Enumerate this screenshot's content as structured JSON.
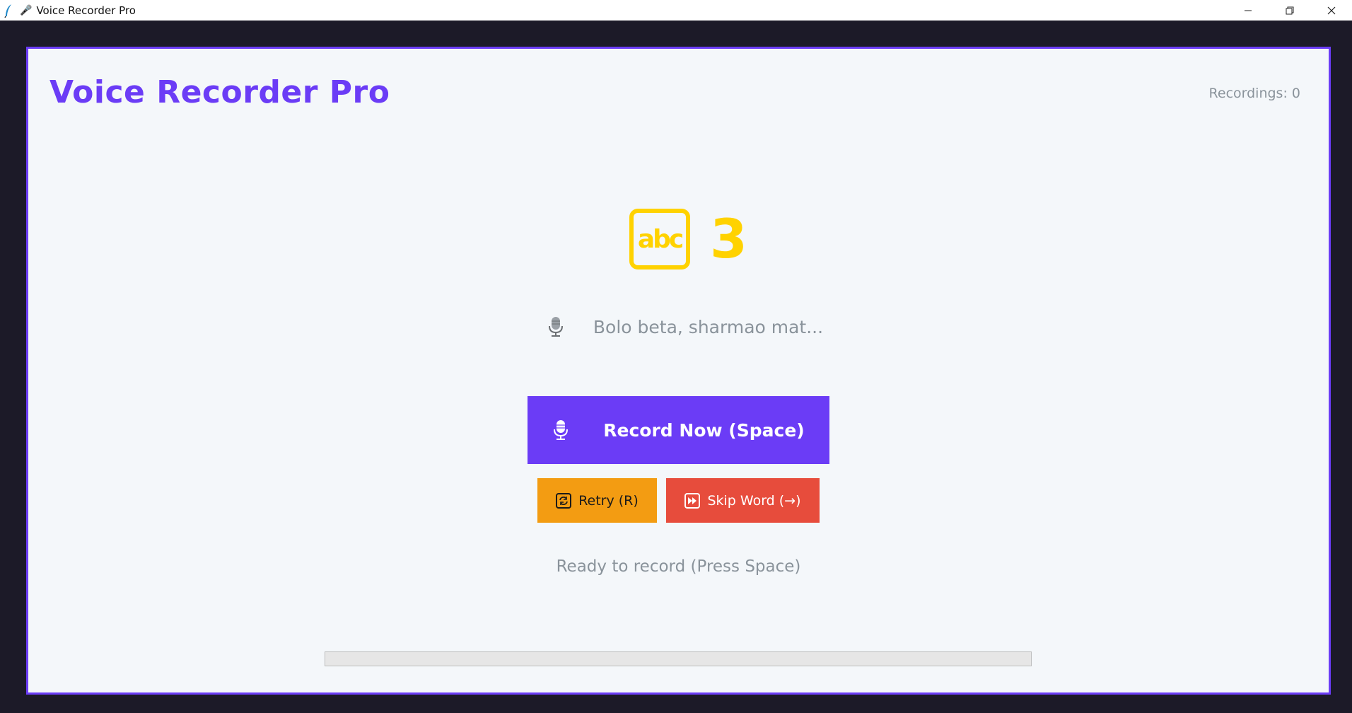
{
  "window": {
    "title": "Voice Recorder Pro",
    "title_emoji": "🎤",
    "controls": {
      "minimize": "—",
      "maximize": "❐",
      "close": "✕"
    }
  },
  "app": {
    "title": "Voice Recorder Pro",
    "recordings_label": "Recordings: 0"
  },
  "word": {
    "icon": "abc-icon",
    "icon_text": "abc",
    "number": "3"
  },
  "prompt": {
    "icon": "microphone-icon",
    "text": "Bolo beta, sharmao mat..."
  },
  "buttons": {
    "record": {
      "label": "Record Now (Space)",
      "icon": "microphone-icon",
      "color": "#6b3cf6"
    },
    "retry": {
      "label": "Retry (R)",
      "icon": "retry-icon",
      "color": "#f39c12"
    },
    "skip": {
      "label": "Skip Word (→)",
      "icon": "fast-forward-icon",
      "color": "#e74c3c"
    }
  },
  "status": {
    "text": "Ready to record (Press Space)"
  },
  "progress": {
    "value": 0
  },
  "colors": {
    "accent": "#6b3cf6",
    "word": "#ffd200",
    "muted_text": "#8a939b"
  }
}
